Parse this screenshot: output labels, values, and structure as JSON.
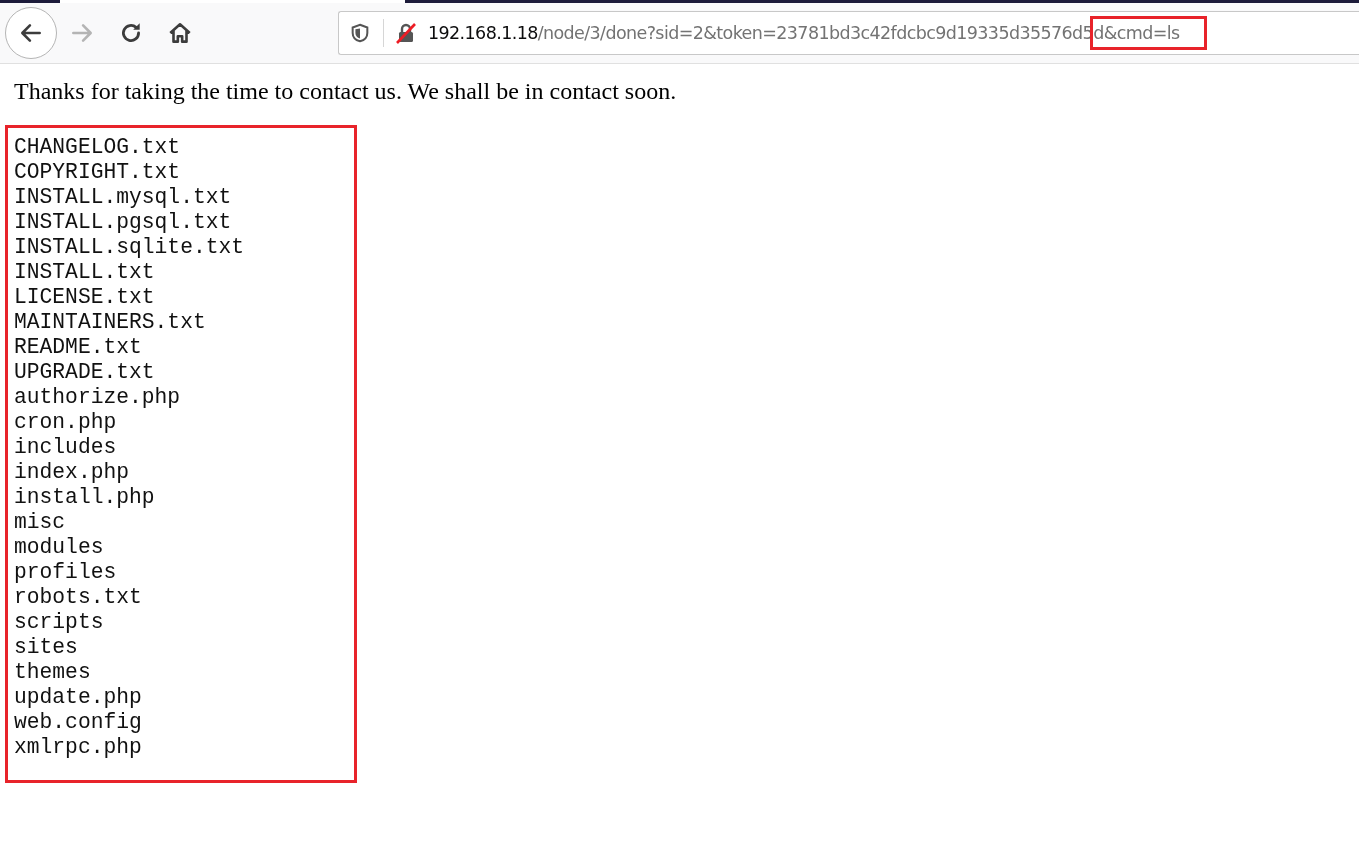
{
  "toolbar": {
    "buttons": [
      {
        "kind": "back",
        "disabled": false
      },
      {
        "kind": "forward",
        "disabled": true
      },
      {
        "kind": "reload",
        "disabled": false
      },
      {
        "kind": "home",
        "disabled": false
      }
    ]
  },
  "address_bar": {
    "host": "192.168.1.18",
    "path": "/node/3/done?sid=2&token=23781bd3c42fdcbc9d19335d35576d5",
    "highlighted_part": "d&cmd=ls",
    "insecure": true
  },
  "message": "Thanks for taking the time to contact us. We shall be in contact soon.",
  "output": {
    "highlighted": true,
    "lines": [
      "CHANGELOG.txt",
      "COPYRIGHT.txt",
      "INSTALL.mysql.txt",
      "INSTALL.pgsql.txt",
      "INSTALL.sqlite.txt",
      "INSTALL.txt",
      "LICENSE.txt",
      "MAINTAINERS.txt",
      "README.txt",
      "UPGRADE.txt",
      "authorize.php",
      "cron.php",
      "includes",
      "index.php",
      "install.php",
      "misc",
      "modules",
      "profiles",
      "robots.txt",
      "scripts",
      "sites",
      "themes",
      "update.php",
      "web.config",
      "xmlrpc.php"
    ]
  }
}
